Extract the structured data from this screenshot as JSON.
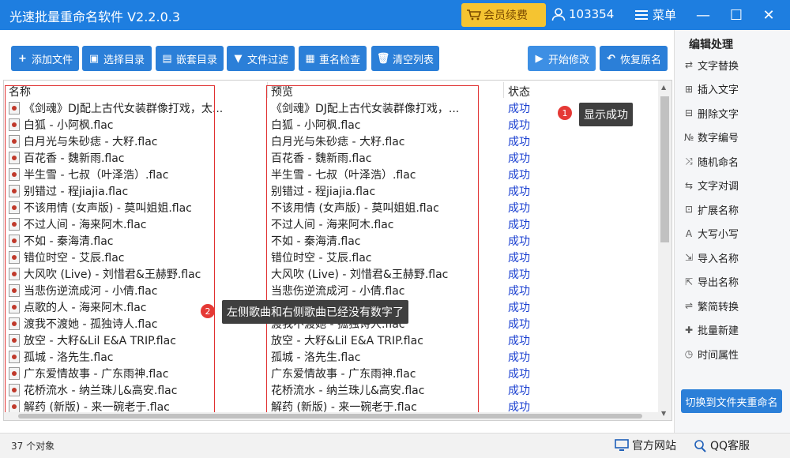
{
  "app": {
    "title": "光速批量重命名软件 V2.2.0.3",
    "vip_label": "会员续费",
    "user_id": "103354",
    "menu_label": "菜单",
    "window_controls": {
      "minimize": "—",
      "maximize": "☐",
      "close": "✕"
    }
  },
  "toolbar": [
    {
      "icon": "plus-icon",
      "label": "添加文件"
    },
    {
      "icon": "folder-add-icon",
      "label": "选择目录"
    },
    {
      "icon": "folder-nest-icon",
      "label": "嵌套目录"
    },
    {
      "icon": "filter-icon",
      "label": "文件过滤"
    },
    {
      "icon": "duplicate-check-icon",
      "label": "重名检查"
    },
    {
      "icon": "trash-icon",
      "label": "清空列表"
    },
    {
      "icon": "play-icon",
      "label": "开始修改"
    },
    {
      "icon": "undo-icon",
      "label": "恢复原名"
    }
  ],
  "columns": {
    "name": "名称",
    "preview": "预览",
    "status": "状态"
  },
  "rows": [
    {
      "name": "《剑魂》DJ配上古代女装群像打戏，太...",
      "preview": "《剑魂》DJ配上古代女装群像打戏，...",
      "status": "成功"
    },
    {
      "name": "白狐 - 小阿枫.flac",
      "preview": "白狐 - 小阿枫.flac",
      "status": "成功"
    },
    {
      "name": "白月光与朱砂痣 - 大籽.flac",
      "preview": "白月光与朱砂痣 - 大籽.flac",
      "status": "成功"
    },
    {
      "name": "百花香 - 魏新雨.flac",
      "preview": "百花香 - 魏新雨.flac",
      "status": "成功"
    },
    {
      "name": "半生雪 - 七叔（叶泽浩）.flac",
      "preview": "半生雪 - 七叔（叶泽浩）.flac",
      "status": "成功"
    },
    {
      "name": "别错过 - 程jiajia.flac",
      "preview": "别错过 - 程jiajia.flac",
      "status": "成功"
    },
    {
      "name": "不该用情 (女声版) - 莫叫姐姐.flac",
      "preview": "不该用情 (女声版) - 莫叫姐姐.flac",
      "status": "成功"
    },
    {
      "name": "不过人间 - 海来阿木.flac",
      "preview": "不过人间 - 海来阿木.flac",
      "status": "成功"
    },
    {
      "name": "不如 - 秦海清.flac",
      "preview": "不如 - 秦海清.flac",
      "status": "成功"
    },
    {
      "name": "错位时空 - 艾辰.flac",
      "preview": "错位时空 - 艾辰.flac",
      "status": "成功"
    },
    {
      "name": "大风吹 (Live) - 刘惜君&王赫野.flac",
      "preview": "大风吹 (Live) - 刘惜君&王赫野.flac",
      "status": "成功"
    },
    {
      "name": "当悲伤逆流成河 - 小倩.flac",
      "preview": "当悲伤逆流成河 - 小倩.flac",
      "status": "成功"
    },
    {
      "name": "点歌的人 - 海来阿木.flac",
      "preview": "点歌的人 - 海来阿木.flac",
      "status": "成功"
    },
    {
      "name": "渡我不渡她 - 孤独诗人.flac",
      "preview": "渡我不渡她 - 孤独诗人.flac",
      "status": "成功"
    },
    {
      "name": "放空 - 大籽&Lil E&A TRIP.flac",
      "preview": "放空 - 大籽&Lil E&A TRIP.flac",
      "status": "成功"
    },
    {
      "name": "孤城 - 洛先生.flac",
      "preview": "孤城 - 洛先生.flac",
      "status": "成功"
    },
    {
      "name": "广东爱情故事 - 广东雨神.flac",
      "preview": "广东爱情故事 - 广东雨神.flac",
      "status": "成功"
    },
    {
      "name": "花桥流水 - 纳兰珠儿&高安.flac",
      "preview": "花桥流水 - 纳兰珠儿&高安.flac",
      "status": "成功"
    },
    {
      "name": "解药 (新版) - 来一碗老于.flac",
      "preview": "解药 (新版) - 来一碗老于.flac",
      "status": "成功"
    }
  ],
  "annotations": [
    {
      "number": "1",
      "text": "显示成功"
    },
    {
      "number": "2",
      "text": "左侧歌曲和右侧歌曲已经没有数字了"
    }
  ],
  "right_panel": {
    "title": "编辑处理",
    "items": [
      {
        "icon": "replace-icon",
        "label": "文字替换"
      },
      {
        "icon": "insert-icon",
        "label": "插入文字"
      },
      {
        "icon": "delete-text-icon",
        "label": "删除文字"
      },
      {
        "icon": "numbering-icon",
        "label": "数字编号"
      },
      {
        "icon": "shuffle-icon",
        "label": "随机命名"
      },
      {
        "icon": "swap-icon",
        "label": "文字对调"
      },
      {
        "icon": "extension-icon",
        "label": "扩展名称"
      },
      {
        "icon": "case-icon",
        "label": "大写小写"
      },
      {
        "icon": "import-icon",
        "label": "导入名称"
      },
      {
        "icon": "export-icon",
        "label": "导出名称"
      },
      {
        "icon": "convert-icon",
        "label": "繁简转换"
      },
      {
        "icon": "batch-new-icon",
        "label": "批量新建"
      },
      {
        "icon": "clock-icon",
        "label": "时间属性"
      }
    ],
    "switch_label": "切换到文件夹重命名"
  },
  "statusbar": {
    "count_text": "37 个对象",
    "website_label": "官方网站",
    "qq_label": "QQ客服"
  },
  "colors": {
    "accent": "#1e7ee0",
    "button": "#2b7fd8",
    "vip": "#f5c431",
    "status": "#1a3fd0",
    "highlight": "#e03030"
  }
}
